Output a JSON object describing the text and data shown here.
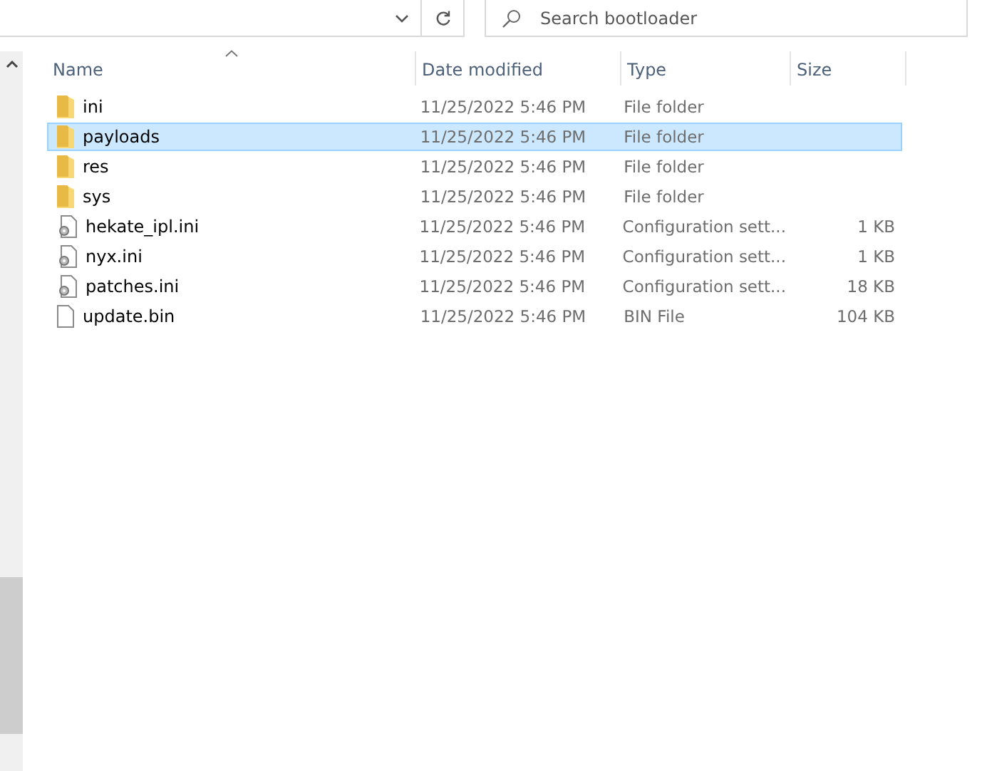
{
  "search": {
    "placeholder": "Search bootloader"
  },
  "columns": [
    {
      "label": "Name",
      "sorted": true
    },
    {
      "label": "Date modified",
      "sorted": false
    },
    {
      "label": "Type",
      "sorted": false
    },
    {
      "label": "Size",
      "sorted": false
    }
  ],
  "rows": [
    {
      "kind": "folder",
      "name": "ini",
      "date": "11/25/2022 5:46 PM",
      "type": "File folder",
      "selected": false
    },
    {
      "kind": "folder",
      "name": "payloads",
      "date": "11/25/2022 5:46 PM",
      "type": "File folder",
      "selected": true
    },
    {
      "kind": "folder",
      "name": "res",
      "date": "11/25/2022 5:46 PM",
      "type": "File folder",
      "selected": false
    },
    {
      "kind": "folder",
      "name": "sys",
      "date": "11/25/2022 5:46 PM",
      "type": "File folder",
      "selected": false
    },
    {
      "kind": "config",
      "name": "hekate_ipl.ini",
      "date": "11/25/2022 5:46 PM",
      "type": "Configuration sett...",
      "size": "1 KB",
      "selected": false
    },
    {
      "kind": "config",
      "name": "nyx.ini",
      "date": "11/25/2022 5:46 PM",
      "type": "Configuration sett...",
      "size": "1 KB",
      "selected": false
    },
    {
      "kind": "config",
      "name": "patches.ini",
      "date": "11/25/2022 5:46 PM",
      "type": "Configuration sett...",
      "size": "18 KB",
      "selected": false
    },
    {
      "kind": "file",
      "name": "update.bin",
      "date": "11/25/2022 5:46 PM",
      "type": "BIN File",
      "size": "104 KB",
      "selected": false
    }
  ]
}
